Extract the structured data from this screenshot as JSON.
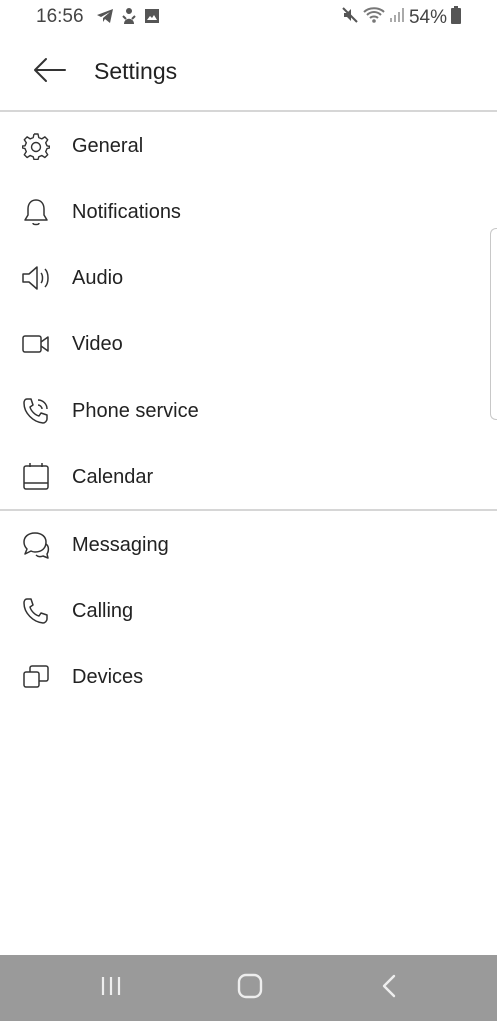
{
  "status_bar": {
    "time": "16:56",
    "battery": "54%",
    "left_icons": [
      "telegram-icon",
      "notification-icon",
      "image-icon"
    ],
    "right_icons": [
      "mute-icon",
      "wifi-icon",
      "signal-icon",
      "battery-icon"
    ]
  },
  "header": {
    "title": "Settings",
    "back_icon": "arrow-left-icon"
  },
  "settings": {
    "group1": [
      {
        "label": "General",
        "icon": "gear-icon"
      },
      {
        "label": "Notifications",
        "icon": "bell-icon"
      },
      {
        "label": "Audio",
        "icon": "speaker-icon"
      },
      {
        "label": "Video",
        "icon": "video-camera-icon"
      },
      {
        "label": "Phone service",
        "icon": "phone-service-icon"
      },
      {
        "label": "Calendar",
        "icon": "calendar-icon"
      }
    ],
    "group2": [
      {
        "label": "Messaging",
        "icon": "chat-bubbles-icon"
      },
      {
        "label": "Calling",
        "icon": "phone-icon"
      },
      {
        "label": "Devices",
        "icon": "devices-icon"
      }
    ]
  },
  "nav_bar": {
    "buttons": [
      "recent-apps-icon",
      "home-icon",
      "back-icon"
    ]
  },
  "colors": {
    "text": "#222222",
    "divider": "#d6d6d6",
    "nav_bar": "#9a9a9a"
  }
}
